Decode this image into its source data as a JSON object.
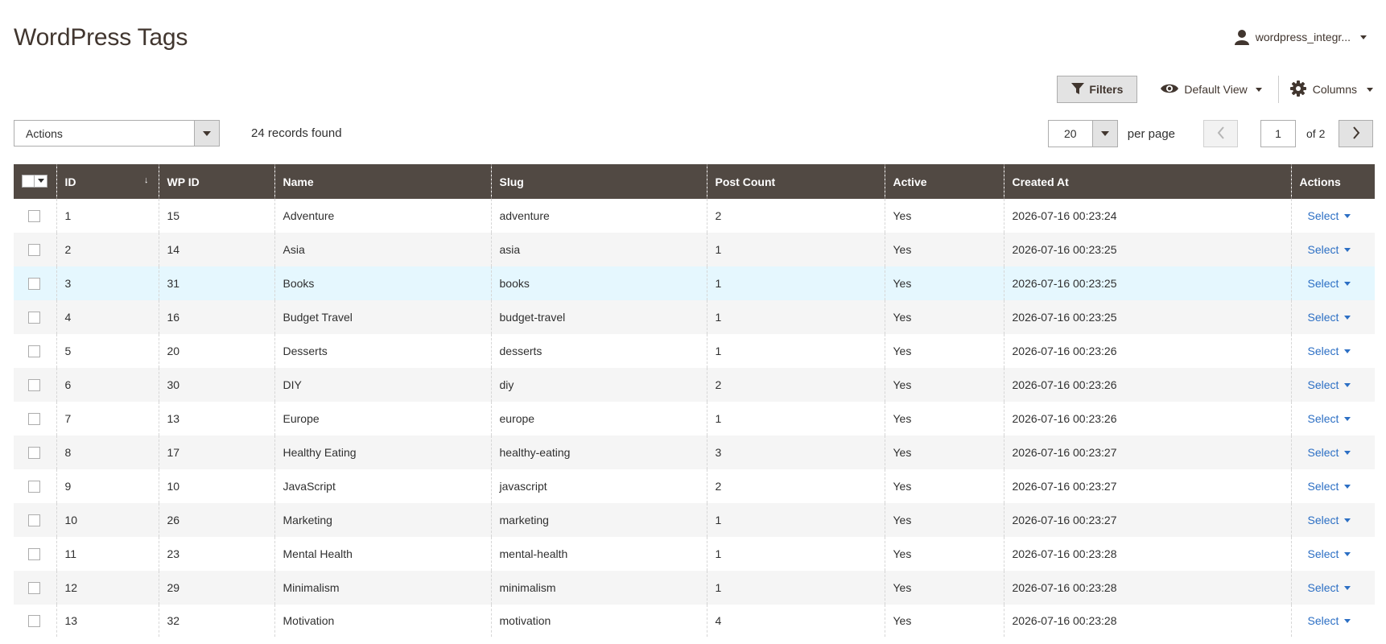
{
  "page": {
    "title": "WordPress Tags"
  },
  "user": {
    "name": "wordpress_integr..."
  },
  "toolbar": {
    "filters_label": "Filters",
    "view_label": "Default View",
    "columns_label": "Columns"
  },
  "mass_actions": {
    "label": "Actions"
  },
  "records_text": "24 records found",
  "pager": {
    "per_page_value": "20",
    "per_page_label": "per page",
    "current_page": "1",
    "of_label": "of 2"
  },
  "columns": [
    "ID",
    "WP ID",
    "Name",
    "Slug",
    "Post Count",
    "Active",
    "Created At",
    "Actions"
  ],
  "row_action_label": "Select",
  "rows": [
    {
      "id": "1",
      "wp_id": "15",
      "name": "Adventure",
      "slug": "adventure",
      "post_count": "2",
      "active": "Yes",
      "created_at": "2026-07-16 00:23:24"
    },
    {
      "id": "2",
      "wp_id": "14",
      "name": "Asia",
      "slug": "asia",
      "post_count": "1",
      "active": "Yes",
      "created_at": "2026-07-16 00:23:25"
    },
    {
      "id": "3",
      "wp_id": "31",
      "name": "Books",
      "slug": "books",
      "post_count": "1",
      "active": "Yes",
      "created_at": "2026-07-16 00:23:25"
    },
    {
      "id": "4",
      "wp_id": "16",
      "name": "Budget Travel",
      "slug": "budget-travel",
      "post_count": "1",
      "active": "Yes",
      "created_at": "2026-07-16 00:23:25"
    },
    {
      "id": "5",
      "wp_id": "20",
      "name": "Desserts",
      "slug": "desserts",
      "post_count": "1",
      "active": "Yes",
      "created_at": "2026-07-16 00:23:26"
    },
    {
      "id": "6",
      "wp_id": "30",
      "name": "DIY",
      "slug": "diy",
      "post_count": "2",
      "active": "Yes",
      "created_at": "2026-07-16 00:23:26"
    },
    {
      "id": "7",
      "wp_id": "13",
      "name": "Europe",
      "slug": "europe",
      "post_count": "1",
      "active": "Yes",
      "created_at": "2026-07-16 00:23:26"
    },
    {
      "id": "8",
      "wp_id": "17",
      "name": "Healthy Eating",
      "slug": "healthy-eating",
      "post_count": "3",
      "active": "Yes",
      "created_at": "2026-07-16 00:23:27"
    },
    {
      "id": "9",
      "wp_id": "10",
      "name": "JavaScript",
      "slug": "javascript",
      "post_count": "2",
      "active": "Yes",
      "created_at": "2026-07-16 00:23:27"
    },
    {
      "id": "10",
      "wp_id": "26",
      "name": "Marketing",
      "slug": "marketing",
      "post_count": "1",
      "active": "Yes",
      "created_at": "2026-07-16 00:23:27"
    },
    {
      "id": "11",
      "wp_id": "23",
      "name": "Mental Health",
      "slug": "mental-health",
      "post_count": "1",
      "active": "Yes",
      "created_at": "2026-07-16 00:23:28"
    },
    {
      "id": "12",
      "wp_id": "29",
      "name": "Minimalism",
      "slug": "minimalism",
      "post_count": "1",
      "active": "Yes",
      "created_at": "2026-07-16 00:23:28"
    },
    {
      "id": "13",
      "wp_id": "32",
      "name": "Motivation",
      "slug": "motivation",
      "post_count": "4",
      "active": "Yes",
      "created_at": "2026-07-16 00:23:28"
    }
  ],
  "icons": {
    "user": "user-icon",
    "filter": "filter-icon",
    "view": "eye-icon",
    "columns": "gear-icon",
    "prev": "chevron-left-icon",
    "next": "chevron-right-icon",
    "sort": "sort-arrow-icon"
  },
  "colors": {
    "header_bg": "#514943",
    "link": "#2c6fc4",
    "highlight_row": "#e5f7fe",
    "title": "#41362f"
  }
}
